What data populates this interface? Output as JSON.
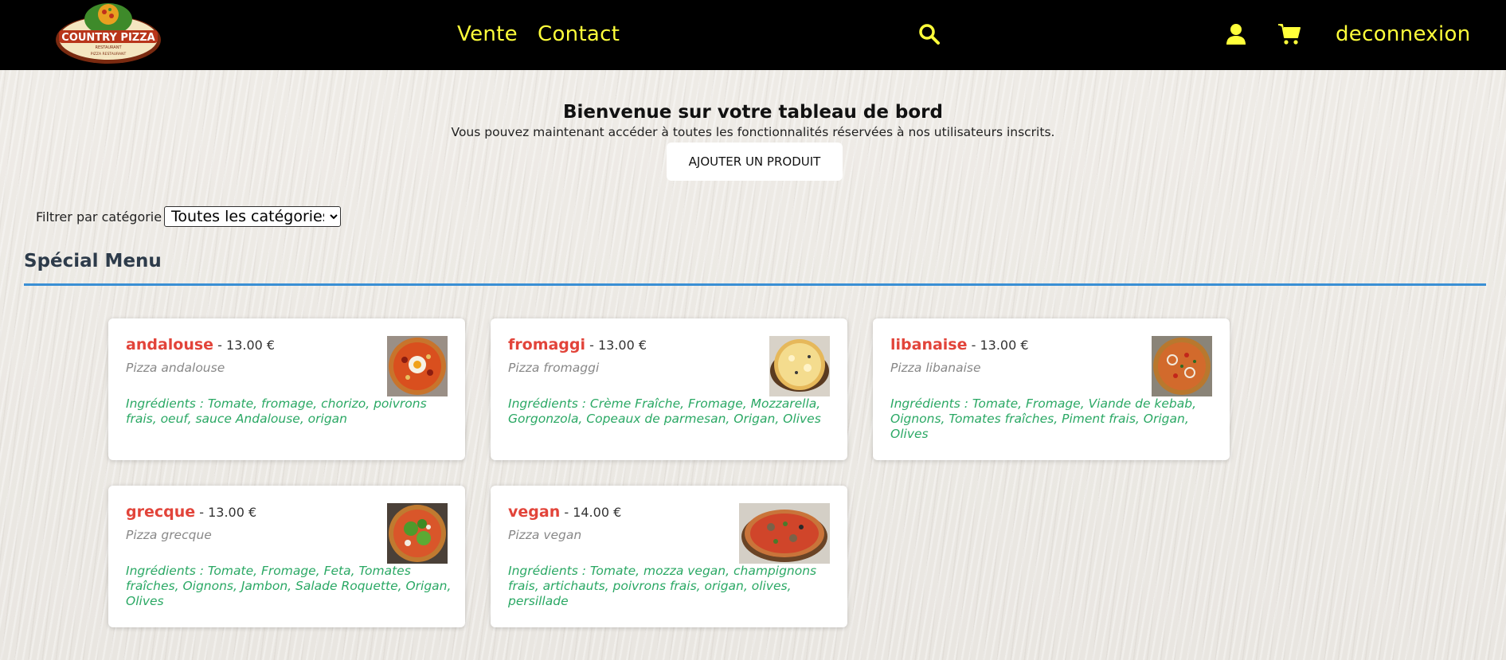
{
  "header": {
    "logo_alt": "Country Pizza Restaurant",
    "logo_text_main": "COUNTRY PIZZA",
    "logo_text_sub": "RESTAURANT",
    "logo_text_bottom": "PIZZA RESTAURANT",
    "nav": [
      {
        "label": "Vente"
      },
      {
        "label": "Contact"
      }
    ],
    "logout_label": "deconnexion",
    "icons": [
      "search-icon",
      "user-icon",
      "cart-icon"
    ],
    "accent_color": "#ffff3a"
  },
  "welcome": {
    "title": "Bienvenue sur votre tableau de bord",
    "subtitle": "Vous pouvez maintenant accéder à toutes les fonctionnalités réservées à nos utilisateurs inscrits.",
    "add_button": "AJOUTER UN PRODUIT"
  },
  "filter": {
    "label": "Filtrer par catégorie :",
    "selected": "Toutes les catégories"
  },
  "section": {
    "title": "Spécial Menu",
    "rule_color": "#3a8fd4"
  },
  "products": [
    {
      "name": "andalouse",
      "price": "- 13.00 €",
      "desc": "Pizza andalouse",
      "ingredients": "Ingrédients : Tomate, fromage, chorizo, poivrons frais, oeuf, sauce Andalouse, origan"
    },
    {
      "name": "fromaggi",
      "price": "- 13.00 €",
      "desc": "Pizza fromaggi",
      "ingredients": "Ingrédients : Crème Fraîche, Fromage, Mozzarella, Gorgonzola, Copeaux de parmesan, Origan, Olives"
    },
    {
      "name": "libanaise",
      "price": "- 13.00 €",
      "desc": "Pizza libanaise",
      "ingredients": "Ingrédients : Tomate, Fromage, Viande de kebab, Oignons, Tomates fraîches, Piment frais, Origan, Olives"
    },
    {
      "name": "grecque",
      "price": "- 13.00 €",
      "desc": "Pizza grecque",
      "ingredients": "Ingrédients : Tomate, Fromage, Feta, Tomates fraîches, Oignons, Jambon, Salade Roquette, Origan, Olives"
    },
    {
      "name": "vegan",
      "price": "- 14.00 €",
      "desc": "Pizza vegan",
      "ingredients": "Ingrédients : Tomate, mozza vegan, champignons frais, artichauts, poivrons frais, origan, olives, persillade"
    }
  ]
}
